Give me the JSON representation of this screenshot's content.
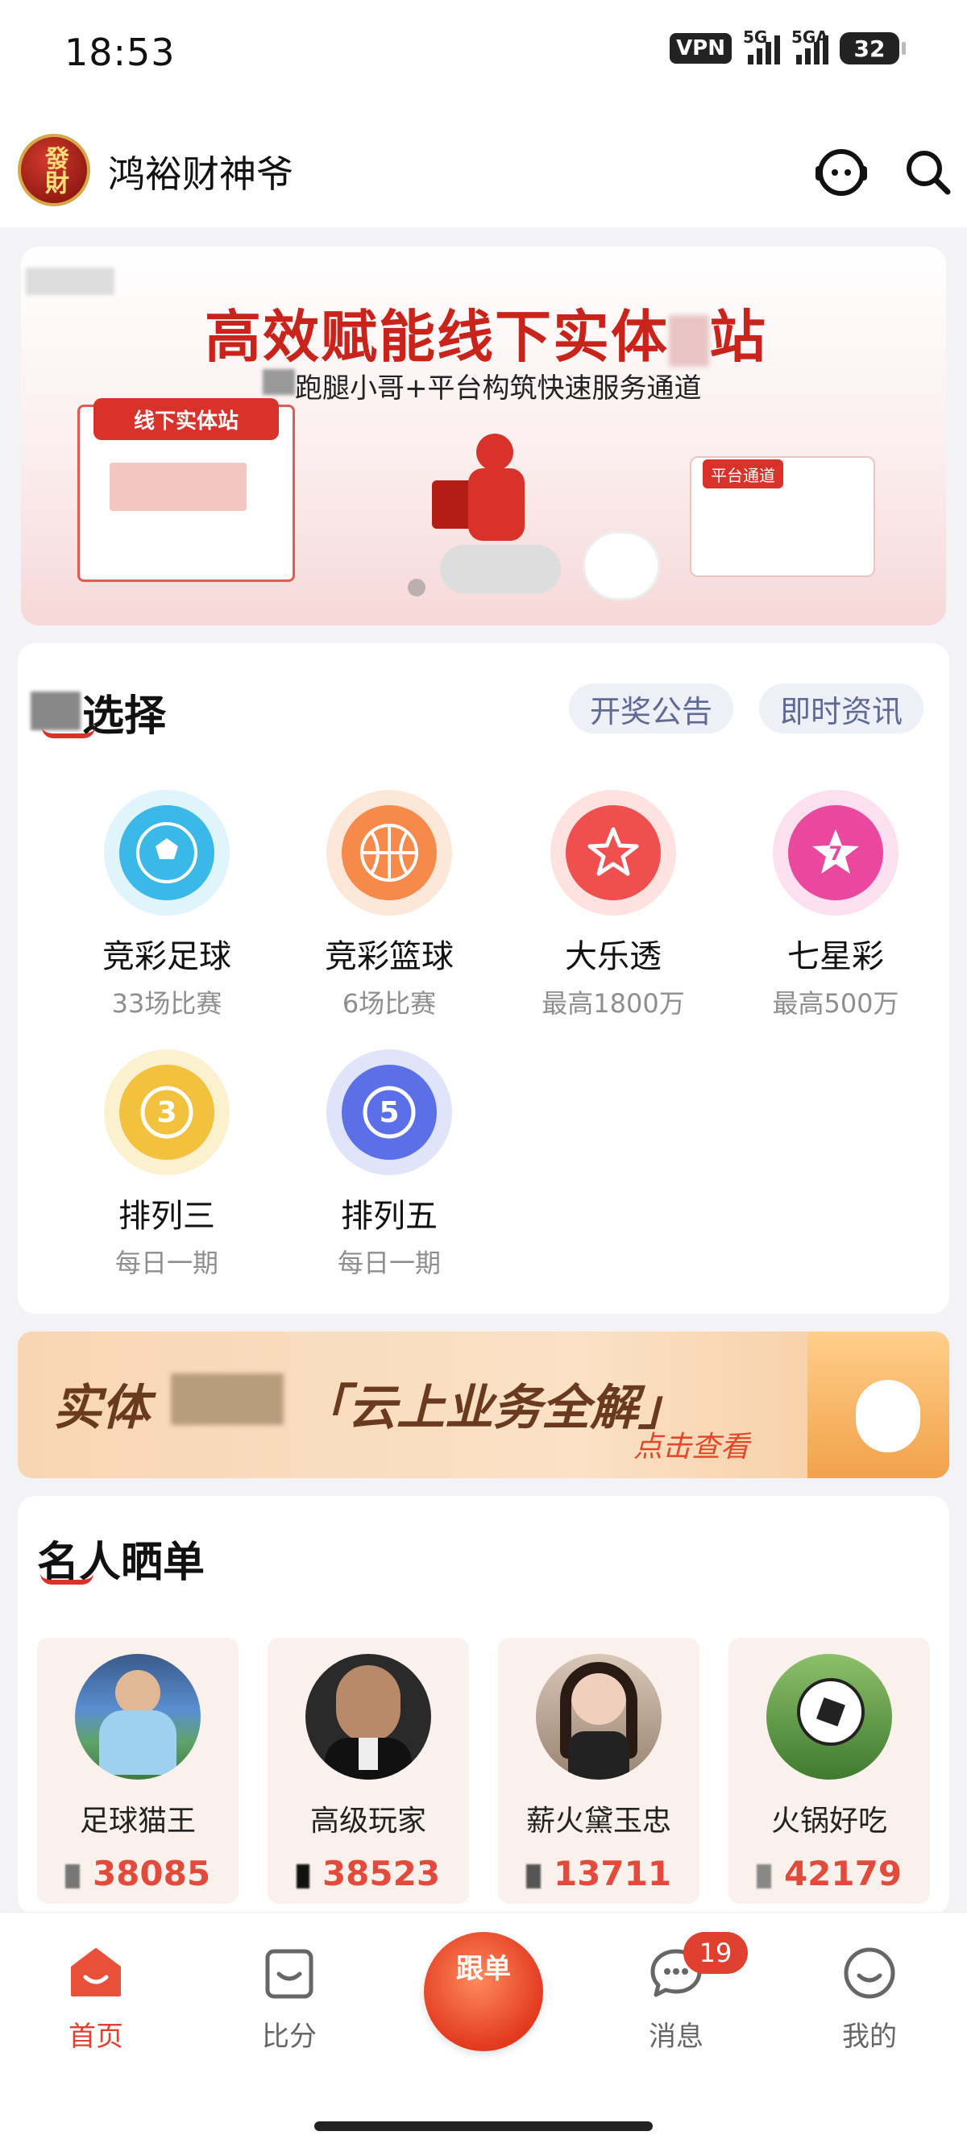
{
  "status_bar": {
    "time": "18:53",
    "vpn": "VPN",
    "signal1_label": "5G",
    "signal2_label": "5GA",
    "battery": "32"
  },
  "header": {
    "logo_text": "發財",
    "app_name": "鸿裕财神爷"
  },
  "banner": {
    "title": "高效赋能线下实体",
    "title_tail": "站",
    "subtitle": "跑腿小哥+平台构筑快速服务通道",
    "kiosk_label": "线下实体站",
    "platform_label": "平台通道"
  },
  "lottery_section": {
    "title": "选择",
    "pills": [
      "开奖公告",
      "即时资讯"
    ],
    "games": [
      {
        "name": "竞彩足球",
        "sub": "33场比赛",
        "icon": "soccer-ball-icon",
        "color": "#3ab8e8"
      },
      {
        "name": "竞彩篮球",
        "sub": "6场比赛",
        "icon": "basketball-icon",
        "color": "#f58a4b"
      },
      {
        "name": "大乐透",
        "sub": "最高1800万",
        "icon": "star-ball-icon",
        "color": "#ef4f4f"
      },
      {
        "name": "七星彩",
        "sub": "最高500万",
        "icon": "seven-star-icon",
        "color": "#e9489e"
      },
      {
        "name": "排列三",
        "sub": "每日一期",
        "icon": "number-three-ball-icon",
        "color": "#f2c23f",
        "glyph": "3"
      },
      {
        "name": "排列五",
        "sub": "每日一期",
        "icon": "number-five-ball-icon",
        "color": "#5b70e8",
        "glyph": "5"
      }
    ]
  },
  "promo": {
    "title_left": "实体",
    "title_right": "「云上业务全解」",
    "link": "点击查看"
  },
  "celebrity_section": {
    "title": "名人晒单",
    "items": [
      {
        "name": "足球猫王",
        "score": "38085"
      },
      {
        "name": "高级玩家",
        "score": "38523"
      },
      {
        "name": "薪火黛玉忠",
        "score": "13711"
      },
      {
        "name": "火锅好吃",
        "score": "42179"
      }
    ]
  },
  "bottom_nav": {
    "items": [
      {
        "label": "首页",
        "icon": "home-icon"
      },
      {
        "label": "比分",
        "icon": "score-icon"
      },
      {
        "label": "跟单",
        "icon": "follow-order-icon"
      },
      {
        "label": "消息",
        "icon": "message-icon"
      },
      {
        "label": "我的",
        "icon": "profile-icon"
      }
    ],
    "message_badge": "19"
  },
  "colors": {
    "accent": "#e0402f",
    "pill_bg": "#eef0f8",
    "pill_text": "#5f6b94"
  }
}
